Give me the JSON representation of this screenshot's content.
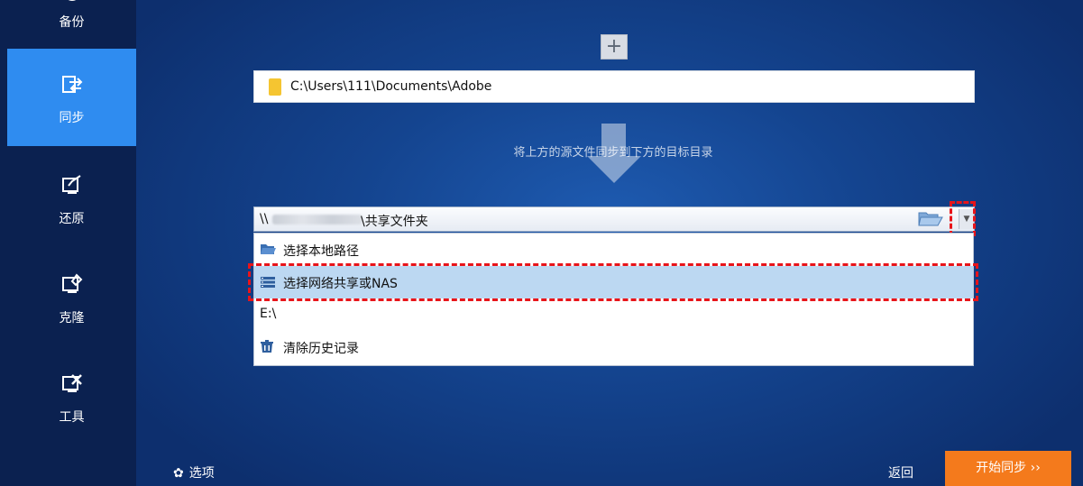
{
  "sidebar": {
    "items": [
      {
        "label": "备份",
        "icon": "backup-icon"
      },
      {
        "label": "同步",
        "icon": "sync-icon",
        "active": true
      },
      {
        "label": "还原",
        "icon": "restore-icon"
      },
      {
        "label": "克隆",
        "icon": "clone-icon"
      },
      {
        "label": "工具",
        "icon": "tools-icon"
      }
    ]
  },
  "main": {
    "add_button": "+",
    "source_path": "C:\\Users\\111\\Documents\\Adobe",
    "hint": "将上方的源文件同步到下方的目标目录",
    "destination": {
      "prefix": "\\\\",
      "suffix": "\\共享文件夹"
    },
    "dropdown_arrow": "▼",
    "menu": [
      {
        "label": "选择本地路径",
        "icon": "folder-icon"
      },
      {
        "label": "选择网络共享或NAS",
        "icon": "network-share-icon",
        "selected": true
      },
      {
        "label": "E:\\"
      },
      {
        "label": "清除历史记录",
        "icon": "clear-history-icon"
      }
    ]
  },
  "footer": {
    "options": "选项",
    "back": "返回",
    "start": "开始同步 ››"
  },
  "colors": {
    "accent": "#2f8cf0",
    "start_button": "#f47a1c",
    "highlight_border": "#e8141a",
    "selected_row": "#bcd8f2"
  }
}
